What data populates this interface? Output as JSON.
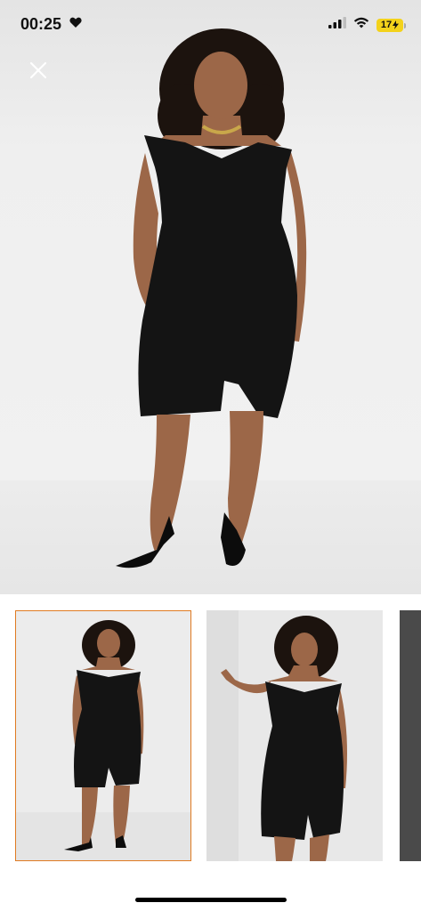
{
  "status_bar": {
    "time": "00:25",
    "battery": "17"
  },
  "icons": {
    "status_heart": "heart-icon",
    "signal": "cellular-signal-icon",
    "wifi": "wifi-icon",
    "battery": "battery-charging-icon",
    "close": "close-icon"
  },
  "colors": {
    "selected_thumb_border": "#e07b22",
    "battery_fill": "#f3d21b",
    "dress": "#141414",
    "skin": "#9c6748",
    "hair": "#1c130e"
  },
  "gallery": {
    "thumbnails": [
      {
        "selected": true
      },
      {
        "selected": false
      },
      {
        "selected": false
      }
    ]
  }
}
